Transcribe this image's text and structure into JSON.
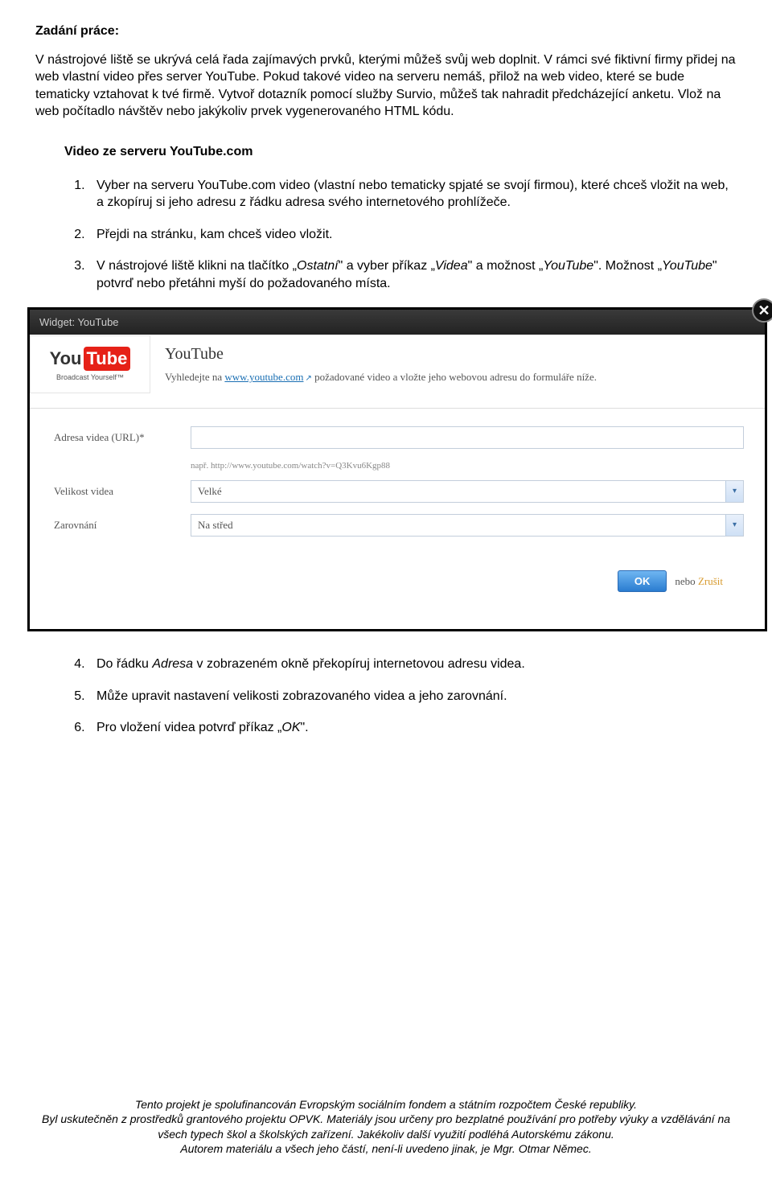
{
  "heading": "Zadání práce:",
  "intro": "V nástrojové liště se ukrývá celá řada zajímavých prvků, kterými můžeš svůj web doplnit. V rámci své fiktivní firmy přidej na web vlastní video přes server YouTube. Pokud takové video na serveru nemáš, přilož na web video, které se bude tematicky vztahovat k tvé firmě. Vytvoř dotazník pomocí služby Survio, můžeš tak nahradit předcházející anketu. Vlož na web počítadlo návštěv nebo jakýkoliv prvek vygenerovaného HTML kódu.",
  "section_title": "Video ze serveru YouTube.com",
  "steps": {
    "s1": "Vyber na serveru YouTube.com video (vlastní nebo tematicky spjaté se svojí firmou), které chceš vložit na web, a zkopíruj si jeho adresu z řádku adresa svého internetového prohlížeče.",
    "s2": "Přejdi na stránku, kam chceš video vložit.",
    "s3a": "V nástrojové liště klikni na tlačítko „",
    "s3b": "Ostatní",
    "s3c": "\" a vyber příkaz „",
    "s3d": "Videa",
    "s3e": "\" a možnost „",
    "s3f": "YouTube",
    "s3g": "\". Možnost „",
    "s3h": "YouTube",
    "s3i": "\" potvrď nebo přetáhni myší do požadovaného místa.",
    "s4a": "Do řádku ",
    "s4b": "Adresa",
    "s4c": " v zobrazeném okně překopíruj internetovou adresu videa.",
    "s5": "Může upravit nastavení velikosti zobrazovaného videa a jeho zarovnání.",
    "s6a": "Pro vložení videa potvrď příkaz „",
    "s6b": "OK",
    "s6c": "\"."
  },
  "widget": {
    "title": "Widget: YouTube",
    "yt_you": "You",
    "yt_tube": "Tube",
    "yt_slogan": "Broadcast Yourself™",
    "hdr_title": "YouTube",
    "hdr_pre": "Vyhledejte na ",
    "hdr_link": "www.youtube.com",
    "hdr_post": " požadované video a vložte jeho webovou adresu do formuláře níže.",
    "lbl_url": "Adresa videa (URL)*",
    "hint": "např. http://www.youtube.com/watch?v=Q3Kvu6Kgp88",
    "lbl_size": "Velikost videa",
    "val_size": "Velké",
    "lbl_align": "Zarovnání",
    "val_align": "Na střed",
    "ok": "OK",
    "nebo": "nebo",
    "cancel": "Zrušit"
  },
  "footer": {
    "l1": "Tento projekt je spolufinancován Evropským sociálním fondem a státním rozpočtem České republiky.",
    "l2": "Byl uskutečněn z prostředků grantového projektu OPVK. Materiály jsou určeny pro bezplatné používání pro potřeby výuky a vzdělávání na všech typech škol a školských zařízení. Jakékoliv další využití podléhá Autorskému zákonu.",
    "l3": "Autorem materiálu a všech jeho částí, není-li uvedeno jinak, je Mgr. Otmar Němec."
  }
}
